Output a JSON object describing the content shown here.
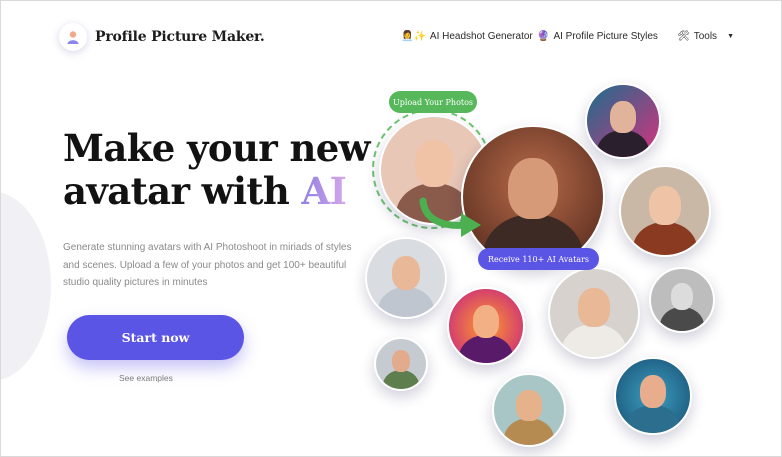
{
  "header": {
    "logo_text": "Profile Picture Maker.",
    "nav": [
      {
        "emoji": "👩‍💼✨",
        "label": "AI Headshot Generator"
      },
      {
        "emoji": "🔮",
        "label": "AI Profile Picture Styles"
      },
      {
        "emoji": "🛠",
        "label": "Tools",
        "caret": "▼"
      }
    ]
  },
  "hero": {
    "title_part1": "Make your new avatar with",
    "title_ai": "AI",
    "description": "Generate stunning avatars with AI Photoshoot in miriads of styles and scenes. Upload a few of your photos and get 100+ beautiful studio quality pictures in minutes",
    "cta_label": "Start now",
    "see_examples": "See examples"
  },
  "showcase": {
    "upload_label": "Upload Your Photos",
    "receive_label": "Receive 110+ AI Avatars"
  },
  "colors": {
    "accent": "#5b55e6",
    "green": "#56b85b"
  }
}
